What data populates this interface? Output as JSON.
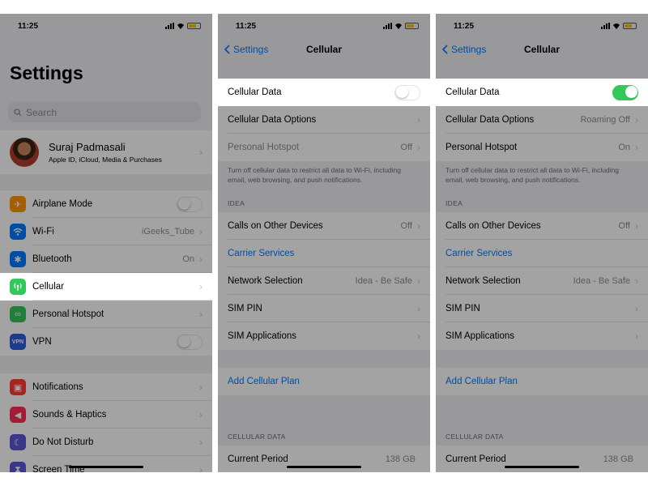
{
  "colors": {
    "accent": "#007aff",
    "toggle_on": "#34c759",
    "background": "#efeff4"
  },
  "panel1": {
    "time": "11:25",
    "title": "Settings",
    "search_placeholder": "Search",
    "profile": {
      "name": "Suraj Padmasali",
      "subtitle": "Apple ID, iCloud, Media & Purchases"
    },
    "items": [
      {
        "label": "Airplane Mode",
        "icon": "airplane-icon",
        "color": "#ff9500",
        "toggle": "off"
      },
      {
        "label": "Wi-Fi",
        "icon": "wifi-icon",
        "color": "#007aff",
        "value": "iGeeks_Tube"
      },
      {
        "label": "Bluetooth",
        "icon": "bluetooth-icon",
        "color": "#007aff",
        "value": "On"
      },
      {
        "label": "Cellular",
        "icon": "cellular-icon",
        "color": "#34c759"
      },
      {
        "label": "Personal Hotspot",
        "icon": "hotspot-icon",
        "color": "#34c759"
      },
      {
        "label": "VPN",
        "icon": "vpn-icon",
        "color": "#2f5dd8",
        "badge": "VPN",
        "toggle": "off"
      },
      {
        "label": "Notifications",
        "icon": "notifications-icon",
        "color": "#ff3b30"
      },
      {
        "label": "Sounds & Haptics",
        "icon": "sounds-icon",
        "color": "#ff2d55"
      },
      {
        "label": "Do Not Disturb",
        "icon": "moon-icon",
        "color": "#5856d6"
      },
      {
        "label": "Screen Time",
        "icon": "hourglass-icon",
        "color": "#5856d6"
      }
    ]
  },
  "panel2": {
    "time": "11:25",
    "back_label": "Settings",
    "title": "Cellular",
    "cellular_data": {
      "label": "Cellular Data",
      "toggle": "off"
    },
    "options": {
      "label": "Cellular Data Options"
    },
    "hotspot": {
      "label": "Personal Hotspot",
      "value": "Off"
    },
    "footer_note": "Turn off cellular data to restrict all data to Wi-Fi, including email, web browsing, and push notifications.",
    "carrier_header": "IDEA",
    "calls": {
      "label": "Calls on Other Devices",
      "value": "Off"
    },
    "carrier_services": "Carrier Services",
    "network": {
      "label": "Network Selection",
      "value": "Idea - Be Safe"
    },
    "sim_pin": "SIM PIN",
    "sim_apps": "SIM Applications",
    "add_plan": "Add Cellular Plan",
    "data_header": "CELLULAR DATA",
    "current_period": {
      "label": "Current Period",
      "value": "138 GB"
    }
  },
  "panel3": {
    "time": "11:25",
    "back_label": "Settings",
    "title": "Cellular",
    "cellular_data": {
      "label": "Cellular Data",
      "toggle": "on"
    },
    "options": {
      "label": "Cellular Data Options",
      "value": "Roaming Off"
    },
    "hotspot": {
      "label": "Personal Hotspot",
      "value": "On"
    },
    "footer_note": "Turn off cellular data to restrict all data to Wi-Fi, including email, web browsing, and push notifications.",
    "carrier_header": "IDEA",
    "calls": {
      "label": "Calls on Other Devices",
      "value": "Off"
    },
    "carrier_services": "Carrier Services",
    "network": {
      "label": "Network Selection",
      "value": "Idea - Be Safe"
    },
    "sim_pin": "SIM PIN",
    "sim_apps": "SIM Applications",
    "add_plan": "Add Cellular Plan",
    "data_header": "CELLULAR DATA",
    "current_period": {
      "label": "Current Period",
      "value": "138 GB"
    }
  }
}
